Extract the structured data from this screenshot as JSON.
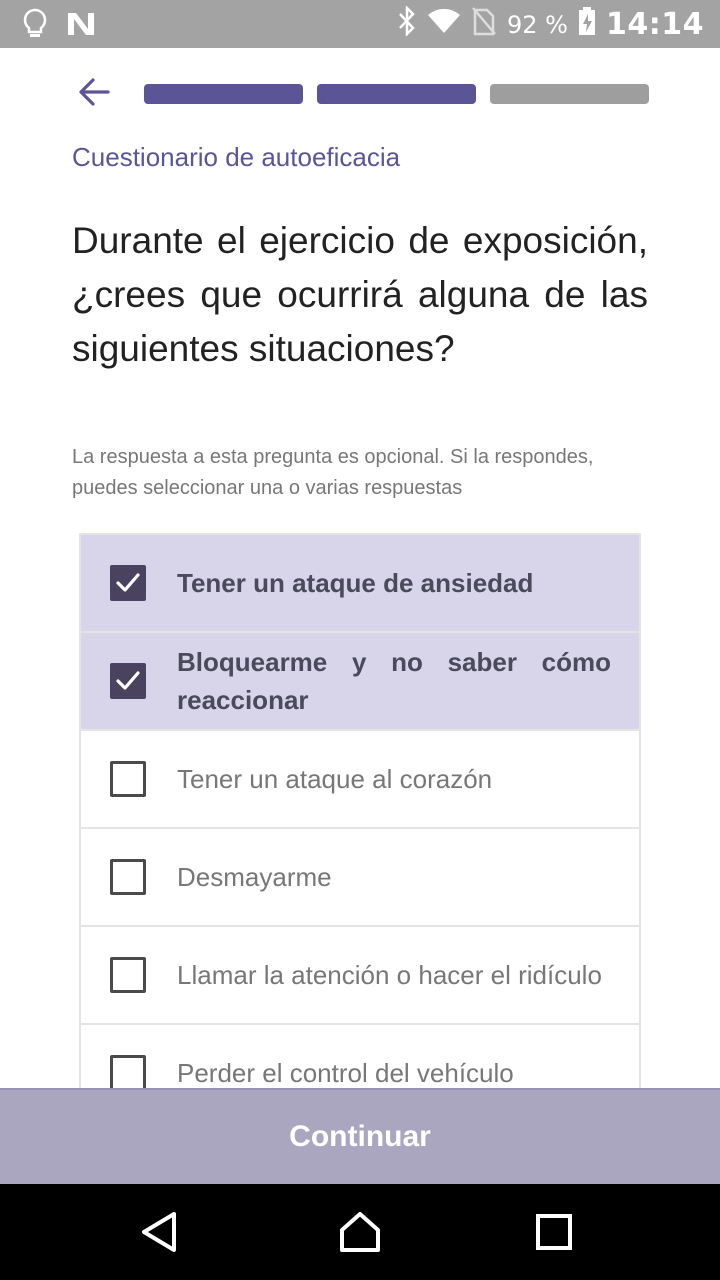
{
  "status_bar": {
    "battery": "92 %",
    "time": "14:14",
    "icons": [
      "lightbulb-icon",
      "n-icon",
      "bluetooth-icon",
      "wifi-icon",
      "no-sim-icon",
      "battery-charging-icon"
    ]
  },
  "header": {
    "back_icon": "arrow-left-icon",
    "progress_steps_total": 3,
    "progress_steps_done": 2
  },
  "subtitle": "Cuestionario de autoeficacia",
  "question": "Durante el ejercicio de exposición, ¿crees que ocurrirá alguna de las siguientes situaciones?",
  "hint": "La respuesta a esta pregunta es opcional. Si la respondes, puedes seleccionar una o varias respuestas",
  "options": [
    {
      "label": "Tener un ataque de ansiedad",
      "checked": true
    },
    {
      "label": "Bloquearme y no saber cómo reaccionar",
      "checked": true
    },
    {
      "label": "Tener un ataque al corazón",
      "checked": false
    },
    {
      "label": "Desmayarme",
      "checked": false
    },
    {
      "label": "Llamar la atención o hacer el ridículo",
      "checked": false
    },
    {
      "label": "Perder el control del vehículo",
      "checked": false
    }
  ],
  "continue_label": "Continuar",
  "nav_bar": {
    "icons": [
      "back-triangle-icon",
      "home-icon",
      "recents-square-icon"
    ]
  },
  "colors": {
    "accent": "#5b5497",
    "selected_bg": "#d8d4ea",
    "button_bg": "#aaa6bf",
    "status_bar": "#a3a3a3"
  }
}
